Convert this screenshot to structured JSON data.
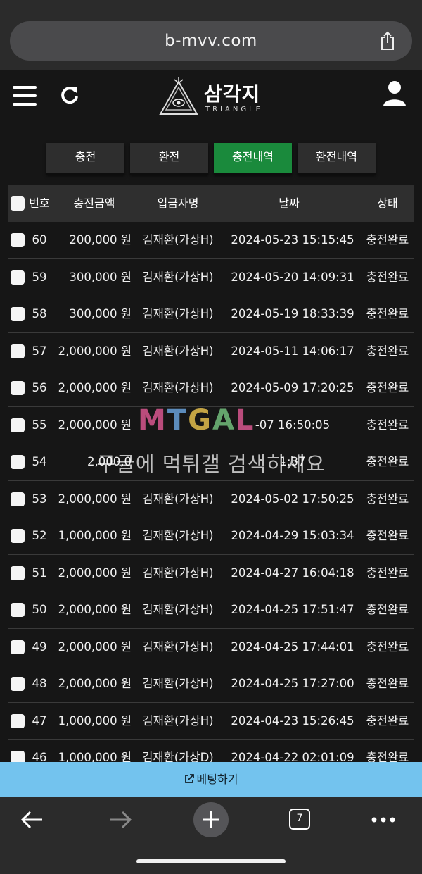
{
  "browser": {
    "url": "b-mvv.com",
    "tab_count": "7"
  },
  "site": {
    "logo_kor": "삼각지",
    "logo_eng": "TRIANGLE"
  },
  "tabs": [
    {
      "label": "충전",
      "active": false
    },
    {
      "label": "환전",
      "active": false
    },
    {
      "label": "충전내역",
      "active": true
    },
    {
      "label": "환전내역",
      "active": false
    }
  ],
  "table": {
    "headers": {
      "no": "번호",
      "amount": "충전금액",
      "depositor": "입금자명",
      "date": "날짜",
      "status": "상태"
    },
    "rows": [
      {
        "no": "60",
        "amount": "200,000 원",
        "depositor": "김재환(가상H)",
        "date": "2024-05-23 15:15:45",
        "status": "충전완료"
      },
      {
        "no": "59",
        "amount": "300,000 원",
        "depositor": "김재환(가상H)",
        "date": "2024-05-20 14:09:31",
        "status": "충전완료"
      },
      {
        "no": "58",
        "amount": "300,000 원",
        "depositor": "김재환(가상H)",
        "date": "2024-05-19 18:33:39",
        "status": "충전완료"
      },
      {
        "no": "57",
        "amount": "2,000,000 원",
        "depositor": "김재환(가상H)",
        "date": "2024-05-11 14:06:17",
        "status": "충전완료"
      },
      {
        "no": "56",
        "amount": "2,000,000 원",
        "depositor": "김재환(가상H)",
        "date": "2024-05-09 17:20:25",
        "status": "충전완료"
      },
      {
        "no": "55",
        "amount": "2,000,000 원",
        "depositor": "",
        "date": "-07 16:50:05",
        "status": "충전완료"
      },
      {
        "no": "54",
        "amount": "2,000,0",
        "depositor": "",
        "date": "1:37",
        "status": "충전완료"
      },
      {
        "no": "53",
        "amount": "2,000,000 원",
        "depositor": "김재환(가상H)",
        "date": "2024-05-02 17:50:25",
        "status": "충전완료"
      },
      {
        "no": "52",
        "amount": "1,000,000 원",
        "depositor": "김재환(가상H)",
        "date": "2024-04-29 15:03:34",
        "status": "충전완료"
      },
      {
        "no": "51",
        "amount": "2,000,000 원",
        "depositor": "김재환(가상H)",
        "date": "2024-04-27 16:04:18",
        "status": "충전완료"
      },
      {
        "no": "50",
        "amount": "2,000,000 원",
        "depositor": "김재환(가상H)",
        "date": "2024-04-25 17:51:47",
        "status": "충전완료"
      },
      {
        "no": "49",
        "amount": "2,000,000 원",
        "depositor": "김재환(가상H)",
        "date": "2024-04-25 17:44:01",
        "status": "충전완료"
      },
      {
        "no": "48",
        "amount": "2,000,000 원",
        "depositor": "김재환(가상H)",
        "date": "2024-04-25 17:27:00",
        "status": "충전완료"
      },
      {
        "no": "47",
        "amount": "1,000,000 원",
        "depositor": "김재환(가상H)",
        "date": "2024-04-23 15:26:45",
        "status": "충전완료"
      },
      {
        "no": "46",
        "amount": "1,000,000 원",
        "depositor": "김재환(가상D)",
        "date": "2024-04-22 02:01:09",
        "status": "충전완료"
      }
    ]
  },
  "watermark": {
    "logo": "MTGAL",
    "text": "구글에 먹튀갤 검색하세요"
  },
  "bet_bar": {
    "label": "베팅하기"
  },
  "colors": {
    "active_tab": "#1a8a3c",
    "bet_bar": "#73c3ee"
  }
}
